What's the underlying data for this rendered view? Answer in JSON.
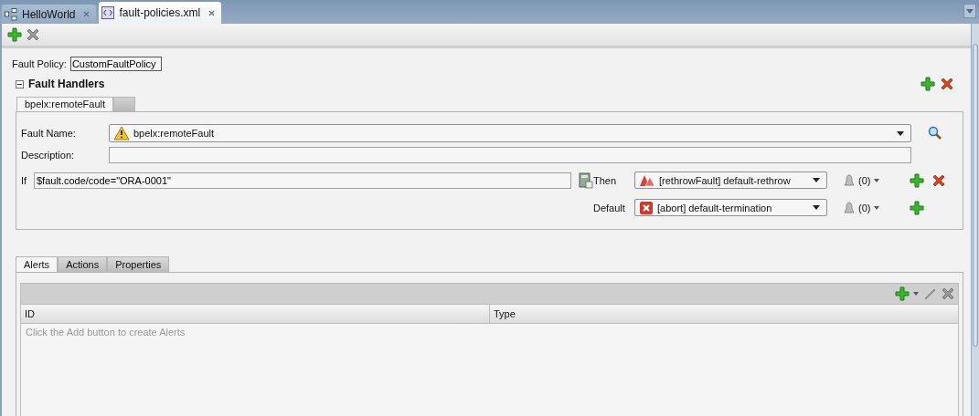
{
  "editor_tabs": [
    {
      "label": "HelloWorld",
      "selected": false,
      "kind": "diagram"
    },
    {
      "label": "fault-policies.xml",
      "selected": true,
      "kind": "xml"
    }
  ],
  "fault_policy": {
    "label": "Fault Policy:",
    "value": "CustomFaultPolicy"
  },
  "fault_handlers": {
    "title": "Fault Handlers",
    "expanded": true,
    "tabs": [
      {
        "label": "bpelx:remoteFault",
        "selected": true
      },
      {
        "selected": false
      }
    ],
    "fault_name": {
      "label": "Fault Name:",
      "value": "bpelx:remoteFault"
    },
    "description": {
      "label": "Description:"
    },
    "condition": {
      "label": "If",
      "value": "$fault.code/code=\"ORA-0001\""
    },
    "actions": [
      {
        "label": "Then",
        "kind": "rethrow",
        "value": "[rethrowFault] default-rethrow",
        "alerts": "(0)",
        "removable": true
      },
      {
        "label": "Default",
        "kind": "abort",
        "value": "[abort] default-termination",
        "alerts": "(0)",
        "removable": false
      }
    ]
  },
  "detail_tabs": [
    {
      "label": "Alerts",
      "selected": true
    },
    {
      "label": "Actions",
      "selected": false
    },
    {
      "label": "Properties",
      "selected": false
    }
  ],
  "alerts_table": {
    "columns": [
      "ID",
      "Type"
    ],
    "empty_text": "Click the Add button to create Alerts"
  }
}
